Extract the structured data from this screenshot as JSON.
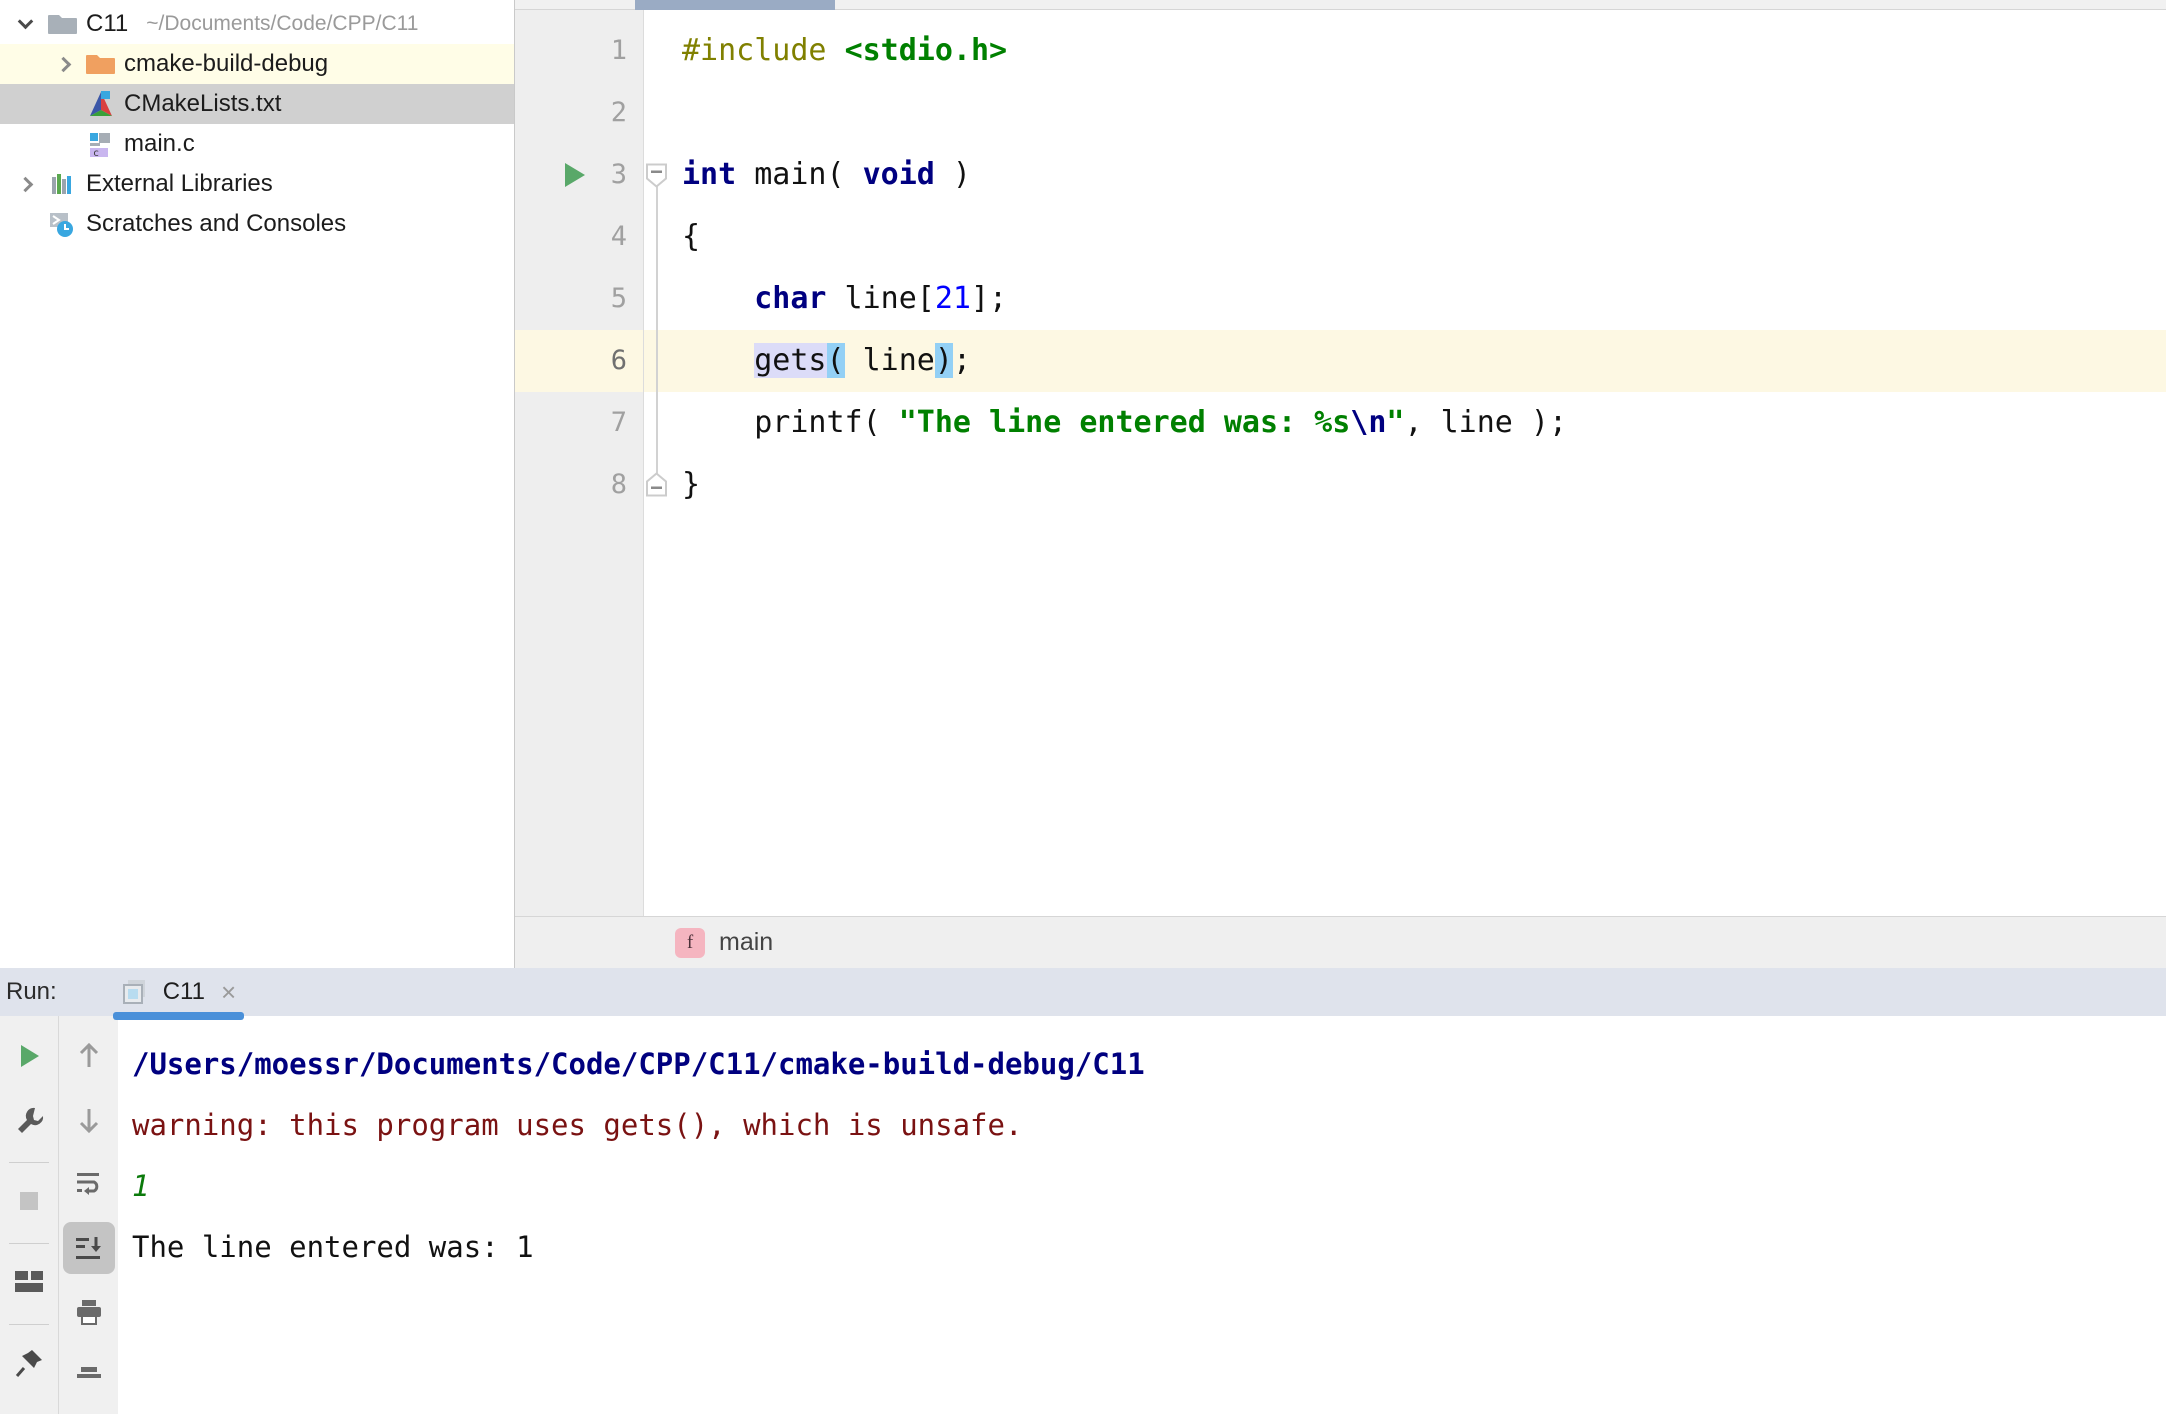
{
  "project_tree": {
    "rows": [
      {
        "name": "root",
        "label": "C11",
        "path": "~/Documents/Code/CPP/C11",
        "icon": "folder-icon",
        "expander": "chevron-down",
        "indent": 0,
        "state": "normal"
      },
      {
        "name": "cmake-build-debug",
        "label": "cmake-build-debug",
        "path": "",
        "icon": "folder-orange-icon",
        "expander": "chevron-right",
        "indent": 1,
        "state": "excluded"
      },
      {
        "name": "cmakelists",
        "label": "CMakeLists.txt",
        "path": "",
        "icon": "cmake-icon",
        "expander": "none",
        "indent": 1,
        "state": "selected"
      },
      {
        "name": "mainc",
        "label": "main.c",
        "path": "",
        "icon": "c-file-icon",
        "expander": "none",
        "indent": 1,
        "state": "normal"
      },
      {
        "name": "external-libraries",
        "label": "External Libraries",
        "path": "",
        "icon": "libraries-icon",
        "expander": "chevron-right",
        "indent": 0,
        "state": "normal"
      },
      {
        "name": "scratches",
        "label": "Scratches and Consoles",
        "path": "",
        "icon": "scratches-icon",
        "expander": "none",
        "indent": 0,
        "state": "normal"
      }
    ]
  },
  "editor": {
    "lines": [
      {
        "num": "1",
        "current": false,
        "run_marker": false,
        "fold": "none"
      },
      {
        "num": "2",
        "current": false,
        "run_marker": false,
        "fold": "none"
      },
      {
        "num": "3",
        "current": false,
        "run_marker": true,
        "fold": "start"
      },
      {
        "num": "4",
        "current": false,
        "run_marker": false,
        "fold": "mid"
      },
      {
        "num": "5",
        "current": false,
        "run_marker": false,
        "fold": "mid"
      },
      {
        "num": "6",
        "current": true,
        "run_marker": false,
        "fold": "mid"
      },
      {
        "num": "7",
        "current": false,
        "run_marker": false,
        "fold": "mid"
      },
      {
        "num": "8",
        "current": false,
        "run_marker": false,
        "fold": "end"
      }
    ],
    "code_text": [
      "#include <stdio.h>",
      "",
      "int main( void )",
      "{",
      "    char line[21];",
      "    gets( line);",
      "    printf( \"The line entered was: %s\\n\", line );",
      "}"
    ],
    "caret_line": "6",
    "breadcrumb": {
      "badge": "f",
      "label": "main"
    }
  },
  "run": {
    "label": "Run:",
    "tab_name": "C11",
    "close_glyph": "×",
    "toolbar_left": [
      {
        "name": "rerun-button",
        "icon": "play-icon"
      },
      {
        "name": "edit-configuration-button",
        "icon": "wrench-icon"
      },
      {
        "name": "stop-button",
        "icon": "stop-square-icon"
      },
      {
        "name": "layout-button",
        "icon": "layout-icon"
      },
      {
        "name": "pin-tab-button",
        "icon": "pin-icon"
      }
    ],
    "toolbar_right": [
      {
        "name": "up-button",
        "icon": "arrow-up-icon",
        "active": false
      },
      {
        "name": "down-button",
        "icon": "arrow-down-icon",
        "active": false
      },
      {
        "name": "soft-wrap-button",
        "icon": "soft-wrap-icon",
        "active": false
      },
      {
        "name": "scroll-to-end-button",
        "icon": "scroll-to-end-icon",
        "active": true
      },
      {
        "name": "print-button",
        "icon": "printer-icon",
        "active": false
      },
      {
        "name": "clear-all-button",
        "icon": "clear-all-icon",
        "active": false
      }
    ],
    "console": [
      {
        "text": "/Users/moessr/Documents/Code/CPP/C11/cmake-build-debug/C11",
        "kind": "path"
      },
      {
        "text": "warning: this program uses gets(), which is unsafe.",
        "kind": "warn"
      },
      {
        "text": "1",
        "kind": "input"
      },
      {
        "text": "The line entered was: 1",
        "kind": "output"
      }
    ]
  },
  "colors": {
    "keyword": "#000080",
    "string": "#008000",
    "preprocessor": "#808000",
    "number": "#0000ff",
    "caret_row": "#fdf8e3",
    "excluded_row": "#fffde7",
    "selected_row": "#d0d0d0",
    "tab_accent": "#4a90d9",
    "console_path": "#00007f",
    "console_warning": "#7a1212",
    "console_input": "#0b7a0b",
    "run_header_bg": "#dfe3ec"
  }
}
